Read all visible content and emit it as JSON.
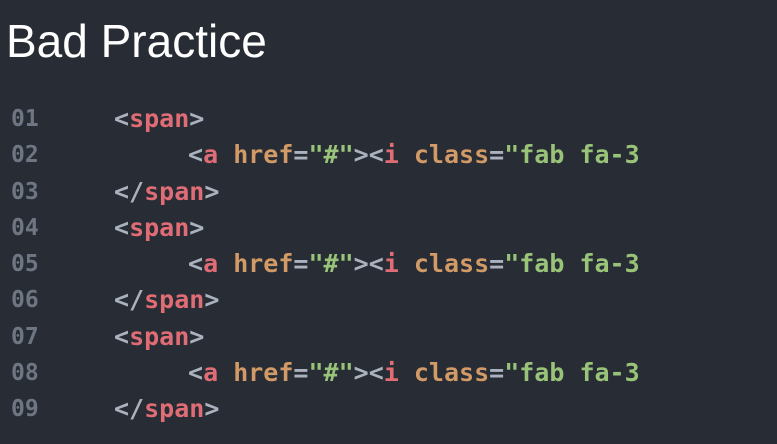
{
  "title": "Bad Practice",
  "colors": {
    "background": "#282c34",
    "line_number": "#6f7683",
    "punctuation": "#abb2bf",
    "tag": "#e06c75",
    "attribute": "#d19a66",
    "string": "#98c379"
  },
  "code": {
    "lines": [
      {
        "number": "01",
        "open": "<",
        "tag": "span",
        "close": ">"
      },
      {
        "number": "02",
        "open": "<",
        "tag": "a",
        "space": " ",
        "attr": "href",
        "eq": "=",
        "value": "\"#\"",
        "gt": ">",
        "open2": "<",
        "tag2": "i",
        "space2": " ",
        "attr2": "class",
        "eq2": "=",
        "value2": "\"fab fa-3"
      },
      {
        "number": "03",
        "open": "</",
        "tag": "span",
        "close": ">"
      },
      {
        "number": "04",
        "open": "<",
        "tag": "span",
        "close": ">"
      },
      {
        "number": "05",
        "open": "<",
        "tag": "a",
        "space": " ",
        "attr": "href",
        "eq": "=",
        "value": "\"#\"",
        "gt": ">",
        "open2": "<",
        "tag2": "i",
        "space2": " ",
        "attr2": "class",
        "eq2": "=",
        "value2": "\"fab fa-3"
      },
      {
        "number": "06",
        "open": "</",
        "tag": "span",
        "close": ">"
      },
      {
        "number": "07",
        "open": "<",
        "tag": "span",
        "close": ">"
      },
      {
        "number": "08",
        "open": "<",
        "tag": "a",
        "space": " ",
        "attr": "href",
        "eq": "=",
        "value": "\"#\"",
        "gt": ">",
        "open2": "<",
        "tag2": "i",
        "space2": " ",
        "attr2": "class",
        "eq2": "=",
        "value2": "\"fab fa-3"
      },
      {
        "number": "09",
        "open": "</",
        "tag": "span",
        "close": ">"
      }
    ]
  }
}
